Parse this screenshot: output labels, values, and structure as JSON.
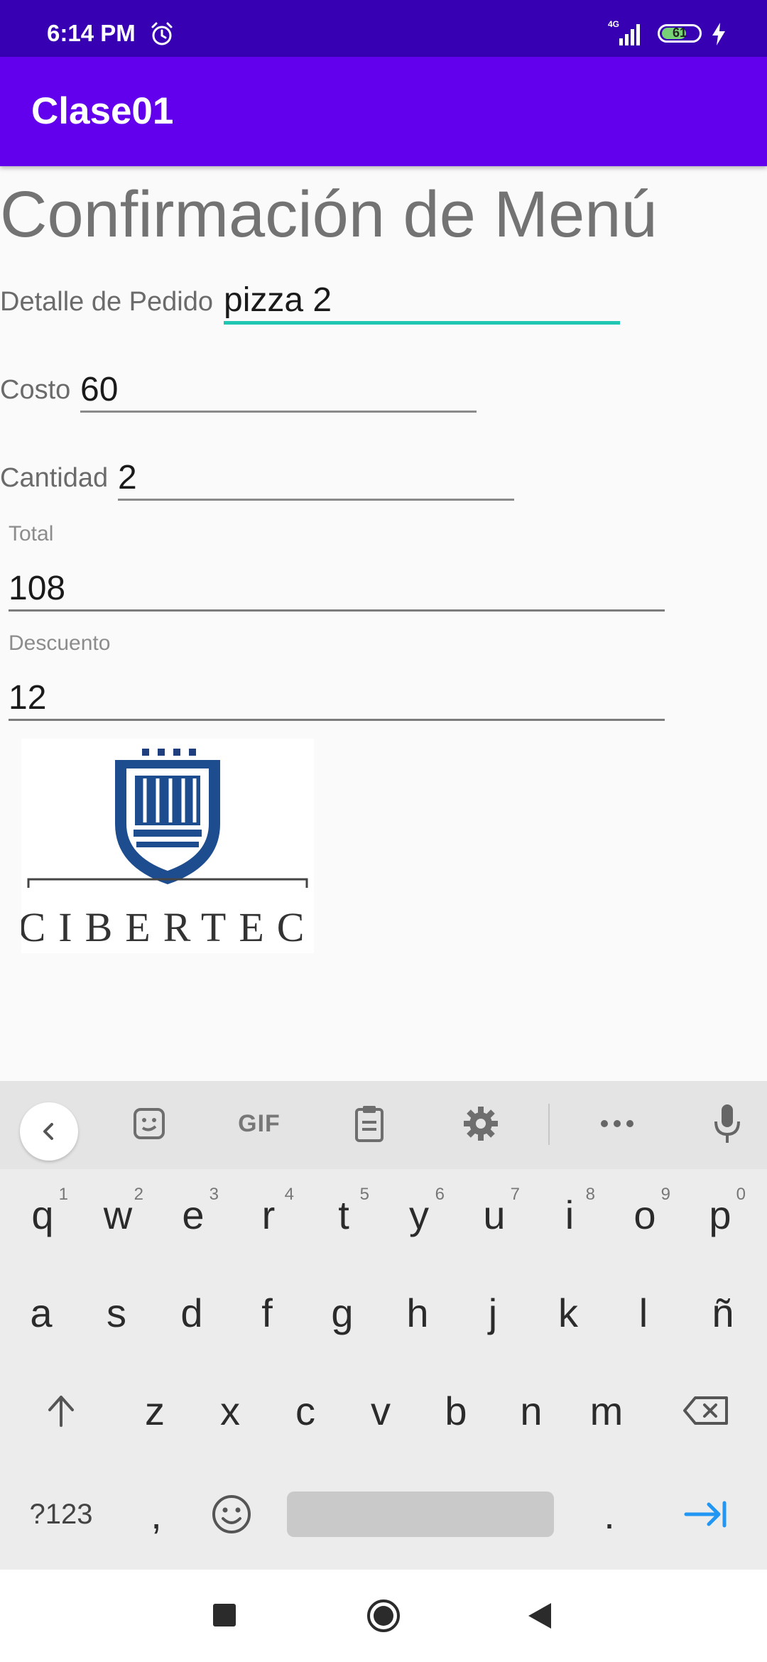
{
  "status_bar": {
    "time": "6:14 PM",
    "network": "4G",
    "battery_level": "61"
  },
  "app_bar": {
    "title": "Clase01"
  },
  "content": {
    "heading": "Confirmación de Menú",
    "detalle_label": "Detalle de Pedido",
    "detalle_value": "pizza 2",
    "costo_label": "Costo",
    "costo_value": "60",
    "cantidad_label": "Cantidad",
    "cantidad_value": "2",
    "total_label": "Total",
    "total_value": "108",
    "descuento_label": "Descuento",
    "descuento_value": "12",
    "logo_text": "CIBERTEC"
  },
  "keyboard": {
    "toolbar": {
      "gif_label": "GIF"
    },
    "row1": [
      {
        "k": "q",
        "n": "1"
      },
      {
        "k": "w",
        "n": "2"
      },
      {
        "k": "e",
        "n": "3"
      },
      {
        "k": "r",
        "n": "4"
      },
      {
        "k": "t",
        "n": "5"
      },
      {
        "k": "y",
        "n": "6"
      },
      {
        "k": "u",
        "n": "7"
      },
      {
        "k": "i",
        "n": "8"
      },
      {
        "k": "o",
        "n": "9"
      },
      {
        "k": "p",
        "n": "0"
      }
    ],
    "row2": [
      "a",
      "s",
      "d",
      "f",
      "g",
      "h",
      "j",
      "k",
      "l",
      "ñ"
    ],
    "row3": [
      "z",
      "x",
      "c",
      "v",
      "b",
      "n",
      "m"
    ],
    "sym_label": "?123",
    "comma": ",",
    "period": "."
  },
  "colors": {
    "status_bar": "#3700b3",
    "app_bar": "#6200ee",
    "focus_underline": "#1fc7b2",
    "enter_key": "#2196f3"
  }
}
